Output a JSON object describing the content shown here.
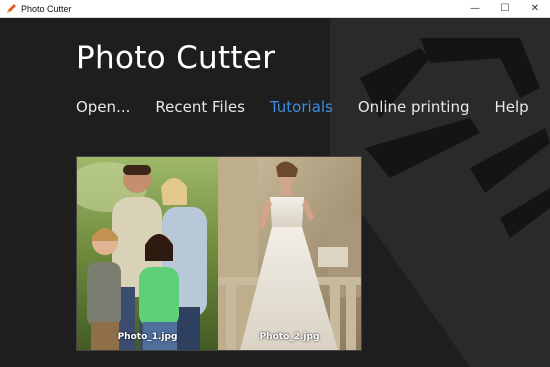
{
  "window": {
    "title": "Photo Cutter",
    "minimize_glyph": "—",
    "maximize_glyph": "☐",
    "close_glyph": "✕",
    "icon": "pencil-icon"
  },
  "app": {
    "title": "Photo Cutter"
  },
  "nav": {
    "items": [
      {
        "label": "Open..."
      },
      {
        "label": "Recent Files"
      },
      {
        "label": "Tutorials",
        "active": true
      },
      {
        "label": "Online printing"
      },
      {
        "label": "Help"
      }
    ]
  },
  "photos": [
    {
      "label": "Photo_1.jpg"
    },
    {
      "label": "Photo_2.jpg"
    }
  ],
  "colors": {
    "background": "#1e1e1e",
    "accent": "#3e8de0",
    "text": "#e8e8e8"
  }
}
